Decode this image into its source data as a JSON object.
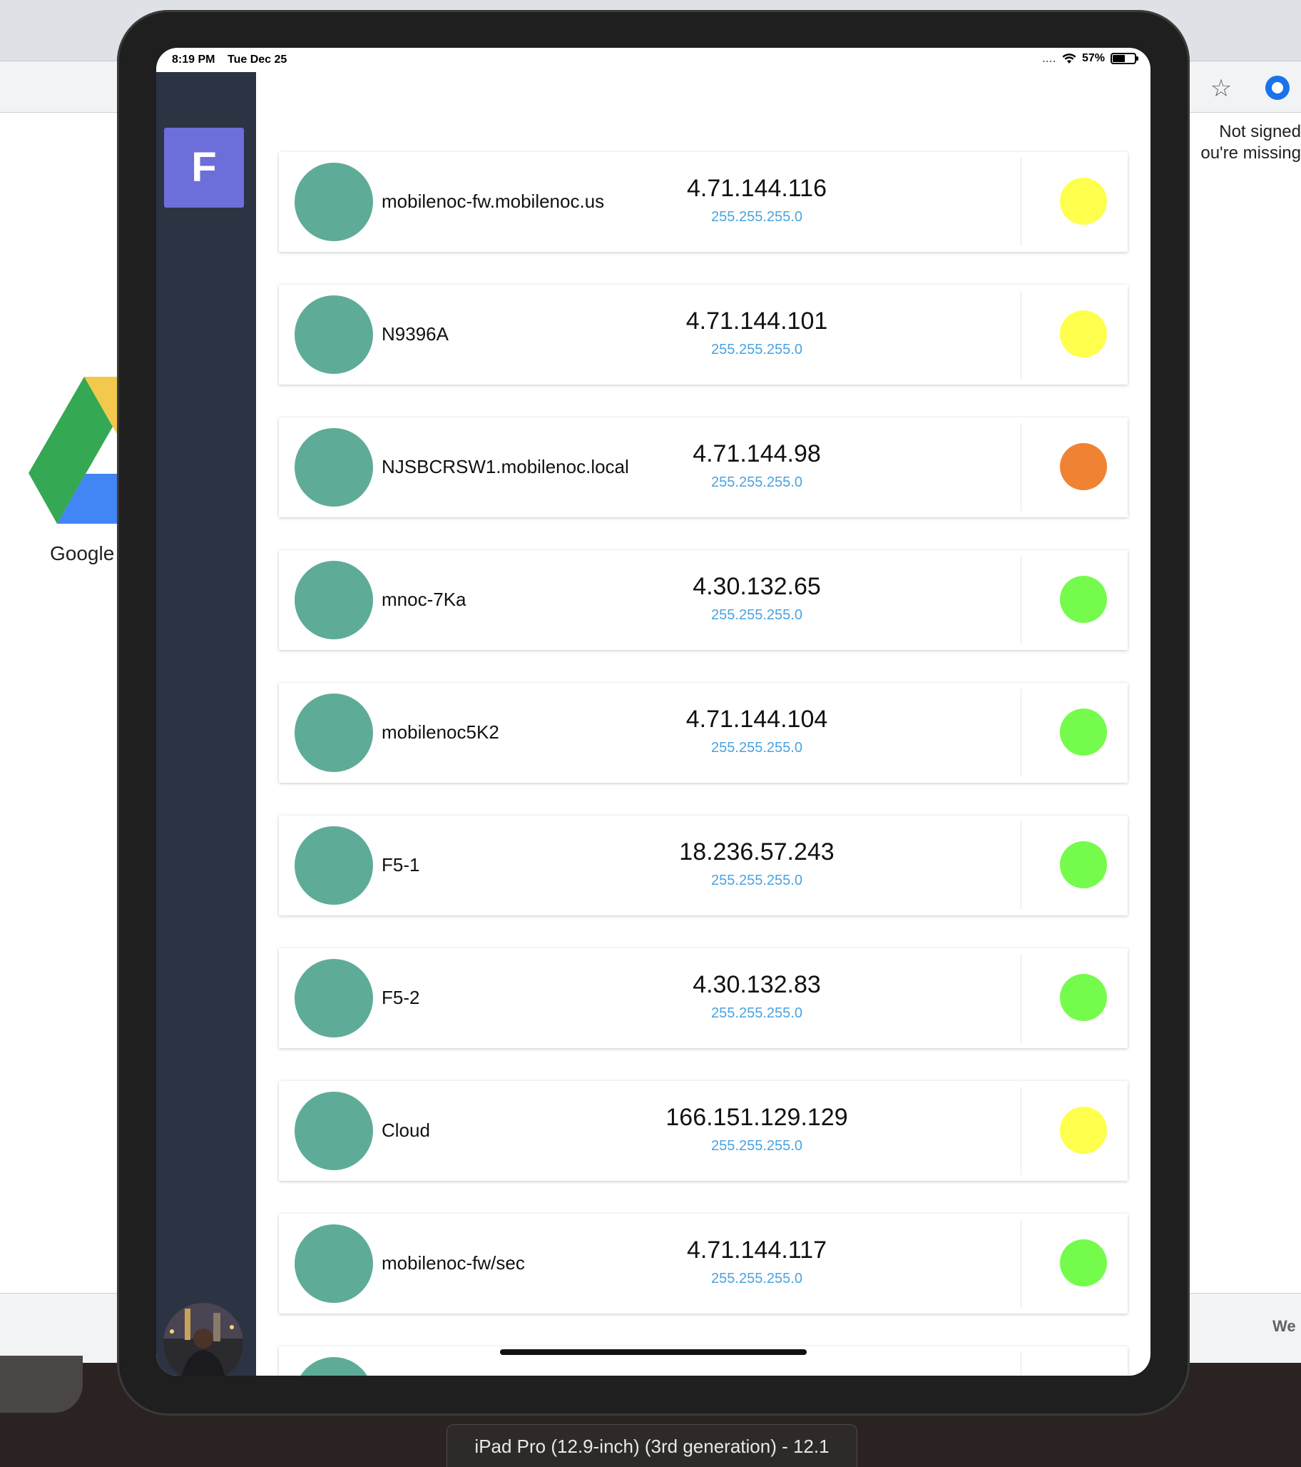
{
  "status_bar": {
    "time": "8:19 PM",
    "date": "Tue Dec 25",
    "signal": "....",
    "battery": "57%"
  },
  "sidebar": {
    "brand_letter": "F",
    "brand_color": "#6d6ed9"
  },
  "devices": [
    {
      "name": "mobilenoc-fw.mobilenoc.us",
      "ip": "4.71.144.116",
      "mask": "255.255.255.0",
      "status": "yellow",
      "status_color": "#ffff4d"
    },
    {
      "name": "N9396A",
      "ip": "4.71.144.101",
      "mask": "255.255.255.0",
      "status": "yellow",
      "status_color": "#ffff4d"
    },
    {
      "name": "NJSBCRSW1.mobilenoc.local",
      "ip": "4.71.144.98",
      "mask": "255.255.255.0",
      "status": "orange",
      "status_color": "#f08333"
    },
    {
      "name": "mnoc-7Ka",
      "ip": "4.30.132.65",
      "mask": "255.255.255.0",
      "status": "green",
      "status_color": "#75fb4c"
    },
    {
      "name": "mobilenoc5K2",
      "ip": "4.71.144.104",
      "mask": "255.255.255.0",
      "status": "green",
      "status_color": "#75fb4c"
    },
    {
      "name": "F5-1",
      "ip": "18.236.57.243",
      "mask": "255.255.255.0",
      "status": "green",
      "status_color": "#75fb4c"
    },
    {
      "name": "F5-2",
      "ip": "4.30.132.83",
      "mask": "255.255.255.0",
      "status": "green",
      "status_color": "#75fb4c"
    },
    {
      "name": "Cloud",
      "ip": "166.151.129.129",
      "mask": "255.255.255.0",
      "status": "yellow",
      "status_color": "#ffff4d"
    },
    {
      "name": "mobilenoc-fw/sec",
      "ip": "4.71.144.117",
      "mask": "255.255.255.0",
      "status": "green",
      "status_color": "#75fb4c"
    },
    {
      "name": "",
      "ip": "",
      "mask": "",
      "status": "",
      "status_color": ""
    }
  ],
  "colors": {
    "sidebar_bg": "#2c3444",
    "device_avatar": "#5eac98",
    "mask_text": "#4aa3df"
  },
  "background_browser": {
    "signin_line1": "Not signed",
    "signin_line2": "ou're missing",
    "drive_label": "Google",
    "footer_text": "We"
  },
  "simulator": {
    "title": "iPad Pro (12.9-inch) (3rd generation) - 12.1"
  }
}
